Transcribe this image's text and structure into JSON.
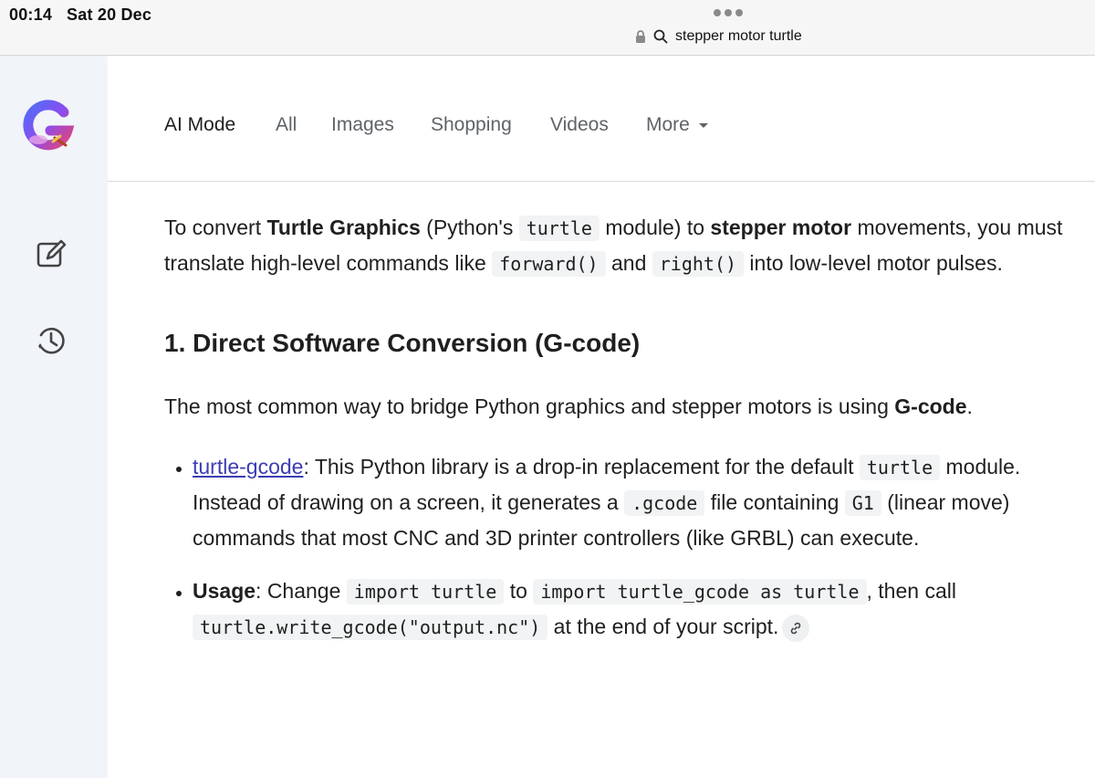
{
  "status": {
    "time": "00:14",
    "date": "Sat 20 Dec"
  },
  "browser": {
    "url_text": "stepper motor turtle",
    "icons": [
      "more-dots-icon",
      "lock-icon",
      "search-icon"
    ]
  },
  "sidebar": {
    "icons": [
      "google-g-logo",
      "new-chat-icon",
      "history-icon"
    ]
  },
  "tabs": [
    {
      "label": "AI Mode",
      "active": true
    },
    {
      "label": "All"
    },
    {
      "label": "Images"
    },
    {
      "label": "Shopping"
    },
    {
      "label": "Videos"
    },
    {
      "label": "More"
    }
  ],
  "content": {
    "intro": {
      "t1": "To convert ",
      "b1": "Turtle Graphics",
      "t2": " (Python's ",
      "c1": "turtle",
      "t3": " module) to ",
      "b2": "stepper motor",
      "t4": " movements, you must translate high-level commands like ",
      "c2": "forward()",
      "t5": " and ",
      "c3": "right()",
      "t6": " into low-level motor pulses."
    },
    "heading": "1. Direct Software Conversion (G-code)",
    "para2": {
      "t1": "The most common way to bridge Python graphics and stepper motors is using ",
      "b1": "G-code",
      "t2": "."
    },
    "bullets": [
      {
        "link": "turtle-gcode",
        "t1": ": This Python library is a drop-in replacement for the default ",
        "c1": "turtle",
        "t2": " module. Instead of drawing on a screen, it generates a ",
        "c2": ".gcode",
        "t3": " file containing ",
        "c3": "G1",
        "t4": " (linear move) commands that most CNC and 3D printer controllers (like GRBL) can execute."
      },
      {
        "b1": "Usage",
        "t1": ": Change ",
        "c1": "import turtle",
        "t2": " to ",
        "c2": "import turtle_gcode as turtle",
        "t3": ", then call ",
        "c3": "turtle.write_gcode(\"output.nc\")",
        "t4": " at the end of your script."
      }
    ]
  },
  "colors": {
    "link": "#3c3cb4",
    "sidebar_bg": "#f1f4f9",
    "code_bg": "#f1f3f4"
  }
}
